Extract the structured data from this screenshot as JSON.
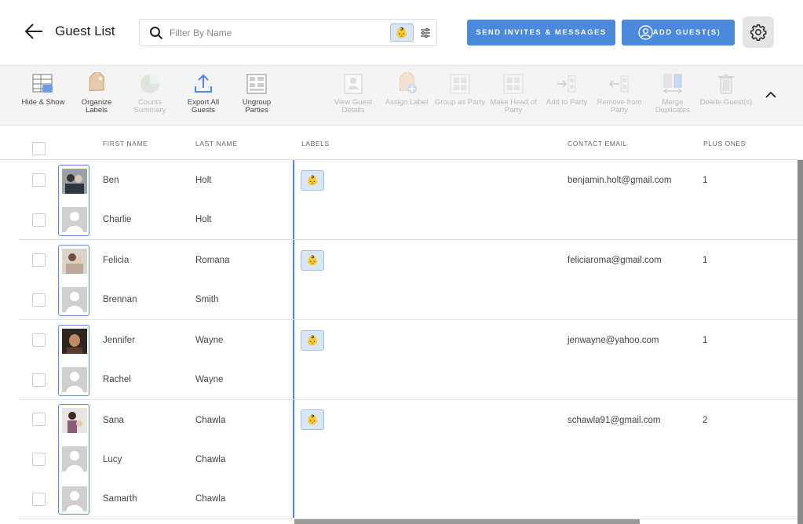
{
  "header": {
    "title": "Guest List",
    "search_placeholder": "Filter By Name",
    "baby_emoji": "👶",
    "send_label": "SEND INVITES & MESSAGES",
    "add_label": "ADD GUEST(S)"
  },
  "toolbar": {
    "hide_show": "Hide & Show",
    "organize_labels": "Organize Labels",
    "counts_summary": "Counts Summary",
    "export_all": "Export All Guests",
    "ungroup": "Ungroup Parties",
    "view_details": "View Guest Details",
    "assign_label": "Assign Label",
    "group_party": "Group as Party",
    "make_head": "Make Head of Party",
    "add_party": "Add to Party",
    "remove_party": "Remove from Party",
    "merge": "Merge Duplicates",
    "delete": "Delete Guest(s)"
  },
  "columns": {
    "first": "FIRST NAME",
    "last": "LAST NAME",
    "labels": "LABELS",
    "email": "CONTACT EMAIL",
    "plus": "PLUS ONES"
  },
  "parties": [
    {
      "label_emoji": "👶",
      "email": "benjamin.holt@gmail.com",
      "plus_ones": "1",
      "guests": [
        {
          "first": "Ben",
          "last": "Holt"
        },
        {
          "first": "Charlie",
          "last": "Holt"
        }
      ]
    },
    {
      "label_emoji": "👶",
      "email": "feliciaroma@gmail.com",
      "plus_ones": "1",
      "guests": [
        {
          "first": "Felicia",
          "last": "Romana"
        },
        {
          "first": "Brennan",
          "last": "Smith"
        }
      ]
    },
    {
      "label_emoji": "👶",
      "email": "jenwayne@yahoo.com",
      "plus_ones": "1",
      "guests": [
        {
          "first": "Jennifer",
          "last": "Wayne"
        },
        {
          "first": "Rachel",
          "last": "Wayne"
        }
      ]
    },
    {
      "label_emoji": "👶",
      "email": "schawla91@gmail.com",
      "plus_ones": "2",
      "guests": [
        {
          "first": "Sana",
          "last": "Chawla"
        },
        {
          "first": "Lucy",
          "last": "Chawla"
        },
        {
          "first": "Samarth",
          "last": "Chawla"
        }
      ]
    }
  ],
  "colors": {
    "accent": "#4a89dc",
    "label_chip": "#d8e7f7"
  }
}
